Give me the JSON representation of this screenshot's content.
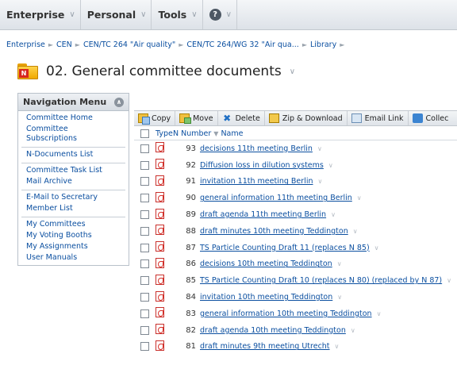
{
  "topbar": {
    "menus": [
      {
        "label": "Enterprise"
      },
      {
        "label": "Personal"
      },
      {
        "label": "Tools"
      }
    ],
    "help_label": "?"
  },
  "breadcrumb": [
    "Enterprise",
    "CEN",
    "CEN/TC 264 \"Air quality\"",
    "CEN/TC 264/WG 32 \"Air qua...",
    "Library"
  ],
  "page": {
    "folder_badge": "N",
    "title": "02. General committee documents"
  },
  "nav": {
    "header": "Navigation Menu",
    "groups": [
      [
        "Committee Home",
        "Committee Subscriptions"
      ],
      [
        "N-Documents List"
      ],
      [
        "Committee Task List",
        "Mail Archive"
      ],
      [
        "E-Mail to Secretary",
        "Member List"
      ],
      [
        "My Committees",
        "My Voting Booths",
        "My Assignments",
        "User Manuals"
      ]
    ]
  },
  "toolbar": {
    "copy": "Copy",
    "move": "Move",
    "delete": "Delete",
    "zip": "Zip & Download",
    "email": "Email Link",
    "collect": "Collec"
  },
  "table": {
    "headers": {
      "type": "Type",
      "number": "N Number",
      "name": "Name"
    },
    "rows": [
      {
        "number": "93",
        "name": "decisions 11th meeting Berlin"
      },
      {
        "number": "92",
        "name": "Diffusion loss in dilution systems"
      },
      {
        "number": "91",
        "name": "invitation 11th meeting Berlin"
      },
      {
        "number": "90",
        "name": "general information 11th meeting Berlin"
      },
      {
        "number": "89",
        "name": "draft agenda 11th meeting Berlin"
      },
      {
        "number": "88",
        "name": "draft minutes 10th meeting Teddington"
      },
      {
        "number": "87",
        "name": "TS Particle Counting Draft 11 (replaces N 85)"
      },
      {
        "number": "86",
        "name": "decisions 10th meeting Teddington"
      },
      {
        "number": "85",
        "name": "TS Particle Counting Draft 10 (replaces N 80) (replaced by N 87)"
      },
      {
        "number": "84",
        "name": "invitation 10th meeting Teddington"
      },
      {
        "number": "83",
        "name": "general information 10th meeting Teddington"
      },
      {
        "number": "82",
        "name": "draft agenda 10th meeting Teddington"
      },
      {
        "number": "81",
        "name": "draft minutes 9th meeting Utrecht"
      }
    ]
  }
}
